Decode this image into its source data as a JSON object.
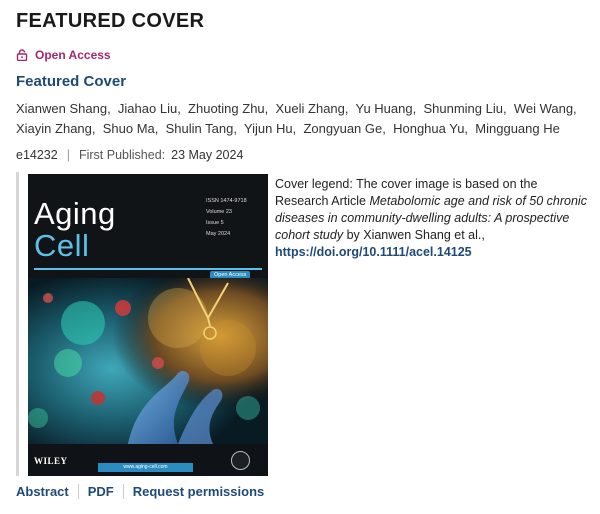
{
  "page": {
    "title": "FEATURED COVER"
  },
  "access": {
    "label": "Open Access",
    "icon": "lock-icon",
    "color": "#a4276d"
  },
  "article": {
    "subtitle": "Featured Cover",
    "authors": [
      "Xianwen Shang,",
      "Jiahao Liu,",
      "Zhuoting Zhu,",
      "Xueli Zhang,",
      "Yu Huang,",
      "Shunming Liu,",
      "Wei Wang,",
      "Xiayin Zhang,",
      "Shuo Ma,",
      "Shulin Tang,",
      "Yijun Hu,",
      "Zongyuan Ge,",
      "Honghua Yu,",
      "Mingguang He"
    ],
    "article_id": "e14232",
    "first_published_label": "First Published:",
    "first_published_date": "23 May 2024"
  },
  "cover": {
    "title_line1": "Aging",
    "title_line2": "Cell",
    "issn": "ISSN 1474-9718",
    "volume": "Volume 23",
    "issue": "Issue 5",
    "date": "May 2024",
    "open_access": "Open Access",
    "publisher": "WILEY",
    "url": "www.aging-cell.com",
    "accent_color": "#5cc1e8"
  },
  "legend": {
    "prefix": "Cover legend: The cover image is based on the Research Article ",
    "article_title": "Metabolomic age and risk of 50 chronic diseases in community-dwelling adults: A prospective cohort study",
    "suffix": " by Xianwen Shang et al.,",
    "doi": "https://doi.org/10.1111/acel.14125"
  },
  "actions": {
    "abstract": "Abstract",
    "pdf": "PDF",
    "request_permissions": "Request permissions"
  },
  "colors": {
    "link": "#1f4a78",
    "text": "#222222"
  }
}
